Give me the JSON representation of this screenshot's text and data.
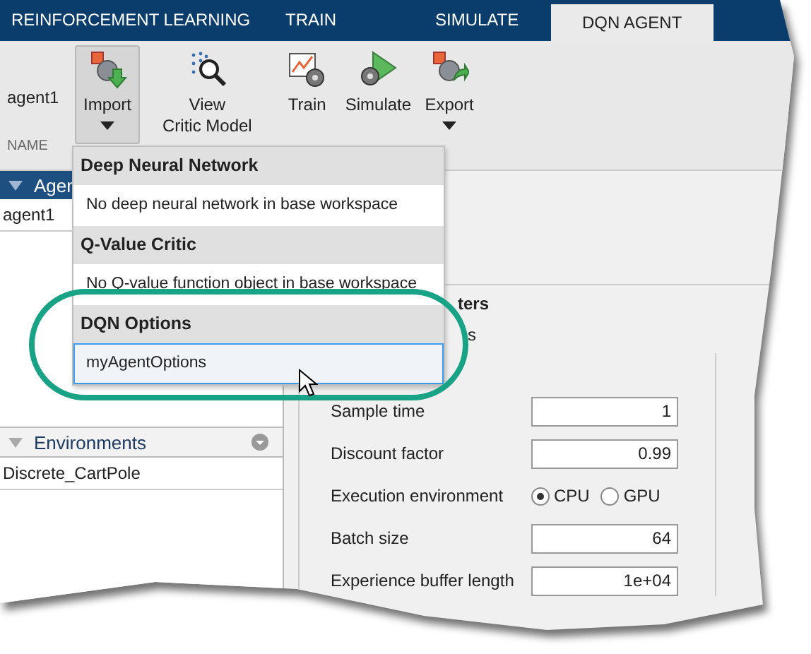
{
  "tabs": [
    {
      "label": "REINFORCEMENT LEARNING",
      "selected": false
    },
    {
      "label": "TRAIN",
      "selected": false
    },
    {
      "label": "SIMULATE",
      "selected": false
    },
    {
      "label": "DQN AGENT",
      "selected": true
    }
  ],
  "toolbar": {
    "agent_name": "agent1",
    "section_label": "NAME",
    "buttons": [
      {
        "kind": "import",
        "label": "Import",
        "dropdown": true,
        "selected": true
      },
      {
        "kind": "view",
        "label": "View\nCritic Model",
        "dropdown": false,
        "selected": false
      },
      {
        "kind": "train",
        "label": "Train",
        "dropdown": false,
        "selected": false
      },
      {
        "kind": "simulate",
        "label": "Simulate",
        "dropdown": false,
        "selected": false
      },
      {
        "kind": "export",
        "label": "Export",
        "dropdown": true,
        "selected": false
      }
    ]
  },
  "agents_panel": {
    "title": "Agen",
    "items": [
      "agent1"
    ]
  },
  "environments_panel": {
    "title": "Environments",
    "items": [
      "Discrete_CartPole"
    ]
  },
  "dropdown": {
    "sections": [
      {
        "header": "Deep Neural Network",
        "items": [
          {
            "label": "No deep neural network in base workspace",
            "selected": false
          }
        ]
      },
      {
        "header": "Q-Value Critic",
        "items": [
          {
            "label": "No Q-value function object in base workspace",
            "selected": false
          }
        ]
      },
      {
        "header": "DQN Options",
        "items": [
          {
            "label": "myAgentOptions",
            "selected": true
          }
        ]
      }
    ]
  },
  "hyperparameters": {
    "heading_fragment": "ters",
    "subheading_fragment": "s",
    "fields": [
      {
        "kind": "text",
        "label": "Sample time",
        "value": "1"
      },
      {
        "kind": "text",
        "label": "Discount factor",
        "value": "0.99"
      },
      {
        "kind": "radio",
        "label": "Execution environment",
        "options": [
          {
            "label": "CPU",
            "selected": true
          },
          {
            "label": "GPU",
            "selected": false
          }
        ]
      },
      {
        "kind": "text",
        "label": "Batch size",
        "value": "64"
      },
      {
        "kind": "text",
        "label": "Experience buffer length",
        "value": "1e+04"
      }
    ]
  }
}
